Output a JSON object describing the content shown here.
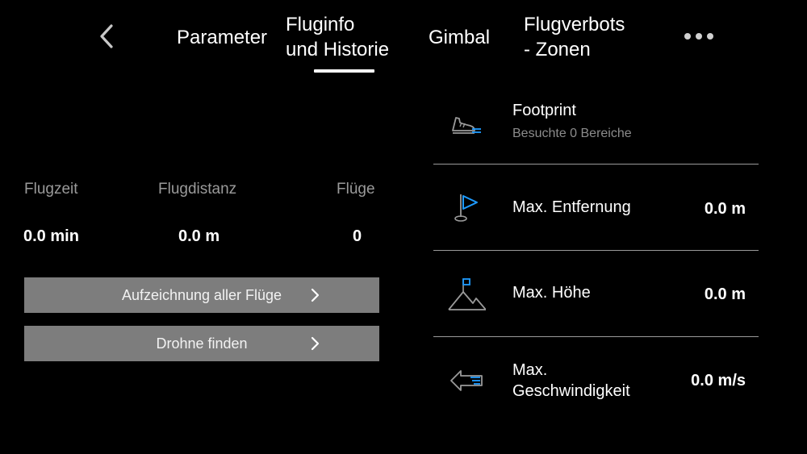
{
  "nav": {
    "tabs": [
      {
        "label": "Parameter"
      },
      {
        "label_line1": "Fluginfo",
        "label_line2": "und Historie",
        "active": true
      },
      {
        "label": "Gimbal"
      },
      {
        "label_line1": "Flugverbots",
        "label_line2": "- Zonen"
      }
    ]
  },
  "stats": [
    {
      "label": "Flugzeit",
      "value": "0.0 min"
    },
    {
      "label": "Flugdistanz",
      "value": "0.0 m"
    },
    {
      "label": "Flüge",
      "value": "0"
    }
  ],
  "buttons": [
    {
      "label": "Aufzeichnung aller Flüge"
    },
    {
      "label": "Drohne finden"
    }
  ],
  "records": [
    {
      "icon": "shoe-icon",
      "title": "Footprint",
      "subtitle": "Besuchte 0 Bereiche"
    },
    {
      "icon": "flag-icon",
      "title": "Max. Entfernung",
      "value": "0.0 m"
    },
    {
      "icon": "mountain-icon",
      "title": "Max. Höhe",
      "value": "0.0 m"
    },
    {
      "icon": "speed-arrow-icon",
      "title_line1": "Max.",
      "title_line2": "Geschwindigkeit",
      "value": "0.0 m/s"
    }
  ],
  "colors": {
    "background": "#000000",
    "accent": "#1e9bff",
    "button": "#7d7d7d",
    "muted": "#9a9a9a"
  }
}
